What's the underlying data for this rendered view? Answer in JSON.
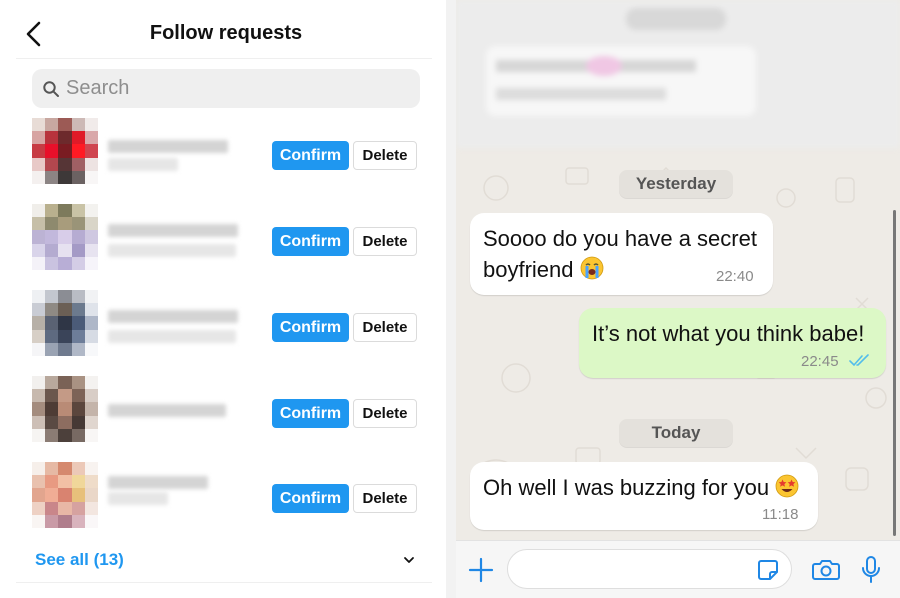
{
  "follow_requests": {
    "header": {
      "title": "Follow requests"
    },
    "search": {
      "placeholder": "Search"
    },
    "requests": [
      {
        "confirm_label": "Confirm",
        "delete_label": "Delete"
      },
      {
        "confirm_label": "Confirm",
        "delete_label": "Delete"
      },
      {
        "confirm_label": "Confirm",
        "delete_label": "Delete"
      },
      {
        "confirm_label": "Confirm",
        "delete_label": "Delete"
      },
      {
        "confirm_label": "Confirm",
        "delete_label": "Delete"
      }
    ],
    "see_all": "See all (13)",
    "colors": {
      "accent": "#1f97f0"
    }
  },
  "chat": {
    "date_yesterday": "Yesterday",
    "date_today": "Today",
    "messages": [
      {
        "direction": "incoming",
        "text": "Soooo do you have a secret boyfriend",
        "emoji": "crying-face",
        "time": "22:40"
      },
      {
        "direction": "outgoing",
        "text": "It’s not what you think babe!",
        "time": "22:45",
        "status": "read"
      },
      {
        "direction": "incoming",
        "text": "Oh well I was buzzing for you",
        "emoji": "star-struck-face",
        "time": "11:18"
      }
    ],
    "colors": {
      "outgoing_bubble": "#dcf8c6",
      "incoming_bubble": "#ffffff",
      "read_ticks": "#53bdeb",
      "icons": "#1f87e5"
    }
  }
}
